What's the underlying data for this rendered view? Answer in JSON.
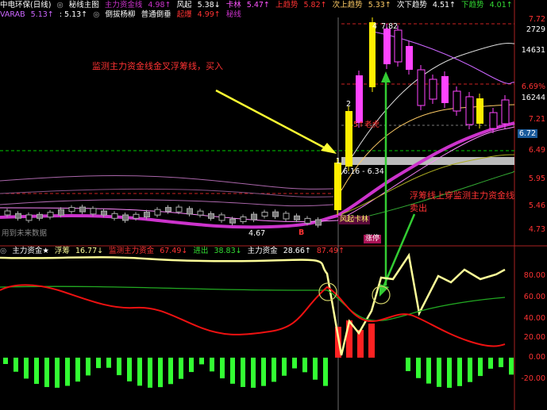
{
  "header1": {
    "title": "中电环保(日线)",
    "template": "秘线主图",
    "main_funds_label": "主力资金线",
    "main_funds_value": "4.98↑",
    "fengqi_label": "风起",
    "fengqi_value": "5.38↓",
    "kalin_label": "卡林",
    "kalin_value": "5.47↑",
    "up_trend_label": "上趋势",
    "up_trend_value": "5.82↑",
    "sub_up_trend_label": "次上趋势",
    "sub_up_trend_value": "5.33↑",
    "sub_down_trend_label": "次下趋势",
    "sub_down_trend_value": "4.51↑",
    "down_trend_label": "下趋势",
    "down_trend_value": "4.01↑"
  },
  "header2": {
    "varab_label": "VARAB",
    "varab_value": "5.13↑",
    "value2": ": 5.13↑",
    "label3": "倒拔杨柳",
    "label4": "普通倒垂",
    "label5": "起爆",
    "value5": "4.99↑",
    "label6": "秘线"
  },
  "main_axis": {
    "ticks": [
      "7.72",
      "7.21",
      "6.72",
      "6.49",
      "5.95",
      "5.46",
      "4.73"
    ],
    "right_values": [
      "2729",
      "14631",
      "6.69%",
      "16244"
    ],
    "highlight_tick": "6.72"
  },
  "annotations": {
    "buy_note": "监测主力资金线金叉浮筹线，买入",
    "sell_note_line1": "浮筹线上穿监测主力资金线",
    "sell_note_line2": "卖出",
    "mark_1": "1",
    "mark_2": "2",
    "mark_4": "4",
    "mark_6": "6",
    "range_label": "6.16 - 6.34",
    "tiger_label": "5↑老虎",
    "peak_label": "7.82",
    "low_label": "4.67",
    "b_label": "B",
    "fengqi_kalin_label": "风起卡林",
    "zhangting_label": "涨停",
    "future_data_label": "用到未来数据"
  },
  "sub_header": {
    "title": "主力资金★",
    "fuchou_label": "浮筹",
    "fuchou_value": "16.77↓",
    "monitor_label": "监测主力资金",
    "monitor_value": "67.49↓",
    "in_label": "进出",
    "in_value": "38.83↓",
    "main_label": "主力资金",
    "main_value": "28.66↑",
    "last_value": "87.49↑"
  },
  "sub_axis": {
    "ticks": [
      "80.00",
      "60.00",
      "40.00",
      "20.00",
      "0.00",
      "-20.00"
    ]
  },
  "colors": {
    "background": "#000000",
    "up": "#ff2d2d",
    "down": "#00ffff",
    "yellow": "#ffff66",
    "magenta": "#ff40ff",
    "purple": "#b040ff",
    "green": "#00cc00",
    "bright_green": "#33ff33",
    "red_line": "#ee1111"
  }
}
